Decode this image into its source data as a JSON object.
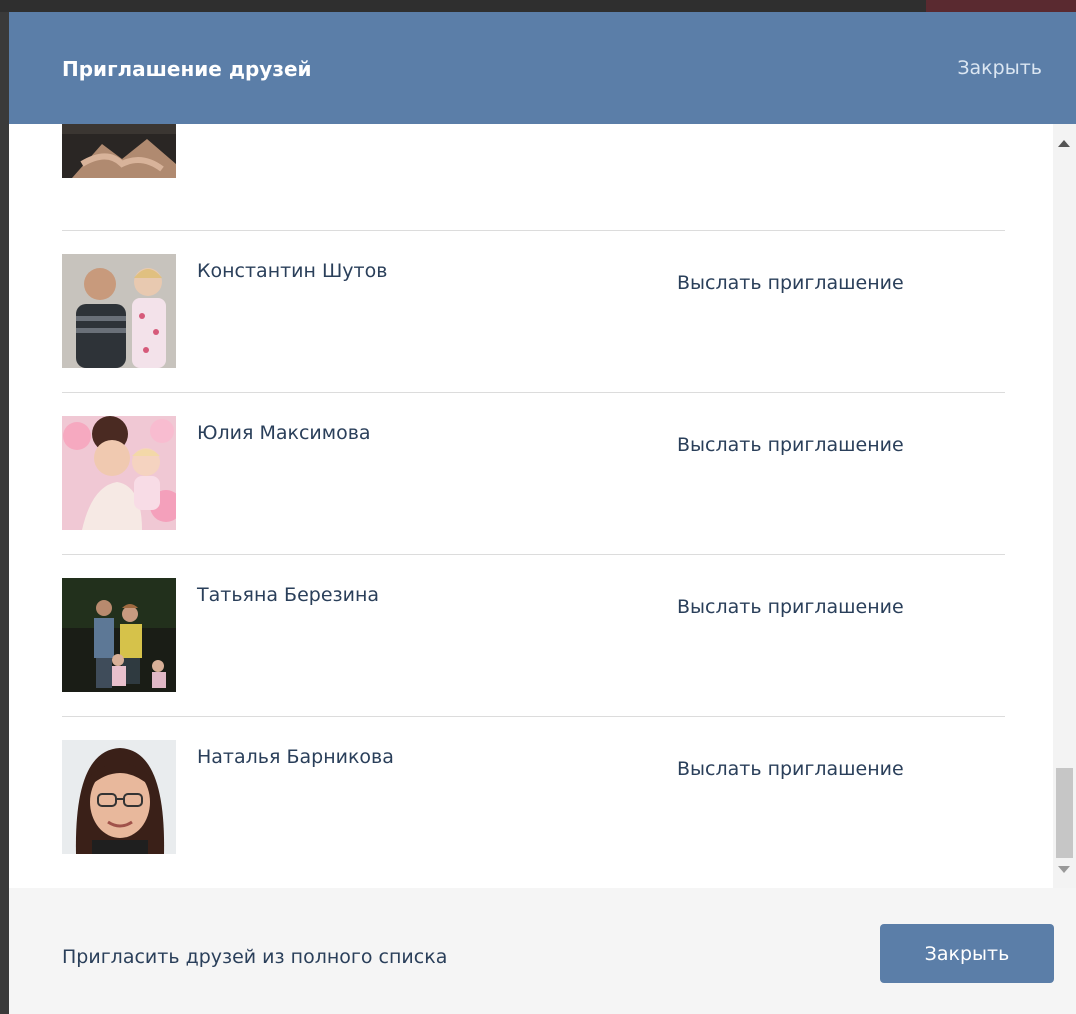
{
  "dialog": {
    "title": "Приглашение друзей",
    "close_label": "Закрыть"
  },
  "friends": [
    {
      "name": "",
      "invite_label": ""
    },
    {
      "name": "Константин Шутов",
      "invite_label": "Выслать приглашение"
    },
    {
      "name": "Юлия Максимова",
      "invite_label": "Выслать приглашение"
    },
    {
      "name": "Татьяна Березина",
      "invite_label": "Выслать приглашение"
    },
    {
      "name": "Наталья Барникова",
      "invite_label": "Выслать приглашение"
    }
  ],
  "footer": {
    "full_list_link": "Пригласить друзей из полного списка",
    "close_button": "Закрыть"
  },
  "colors": {
    "header_bg": "#5b7ea8",
    "button_bg": "#5b7ea8",
    "text": "#2a3f5a",
    "footer_bg": "#f5f5f5"
  }
}
